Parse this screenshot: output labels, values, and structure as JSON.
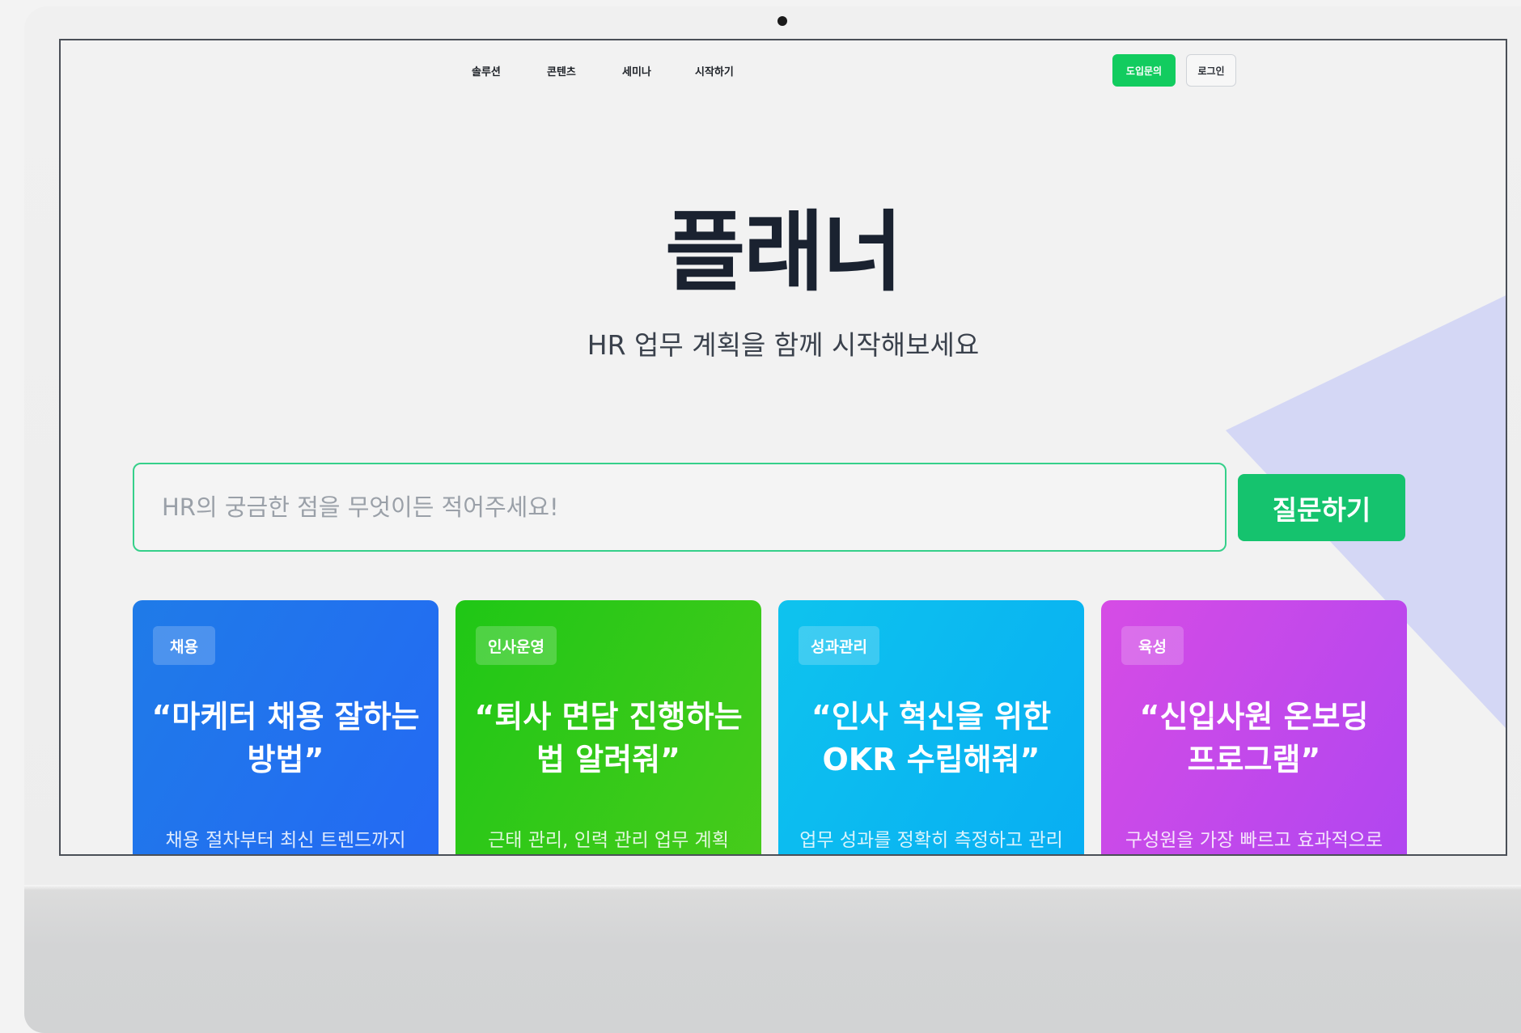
{
  "nav": {
    "links": [
      "솔루션",
      "콘텐츠",
      "세미나",
      "시작하기"
    ],
    "inquiry_label": "도입문의",
    "login_label": "로그인"
  },
  "hero": {
    "title": "플래너",
    "subtitle": "HR 업무 계획을 함께 시작해보세요"
  },
  "search": {
    "placeholder": "HR의 궁금한 점을 무엇이든 적어주세요!",
    "button_label": "질문하기"
  },
  "cards": [
    {
      "badge": "채용",
      "title_line1": "“마케터 채용 잘하는",
      "title_line2": "방법”",
      "desc": "채용 절차부터 최신 트렌드까지",
      "color": "#2370ef"
    },
    {
      "badge": "인사운영",
      "title_line1": "“퇴사 면담 진행하는",
      "title_line2": "법 알려줘”",
      "desc": "근태 관리, 인력 관리 업무 계획",
      "color": "#2ec918"
    },
    {
      "badge": "성과관리",
      "title_line1": "“인사 혁신을 위한",
      "title_line2": "OKR 수립해줘”",
      "desc": "업무 성과를 정확히 측정하고 관리",
      "color": "#0bb9f0"
    },
    {
      "badge": "육성",
      "title_line1": "“신입사원 온보딩",
      "title_line2": "프로그램”",
      "desc": "구성원을 가장 빠르고 효과적으로",
      "color": "#c34aeb"
    }
  ],
  "colors": {
    "accent": "#12cc5f",
    "title": "#1a2230",
    "input_border": "#35d08a"
  }
}
